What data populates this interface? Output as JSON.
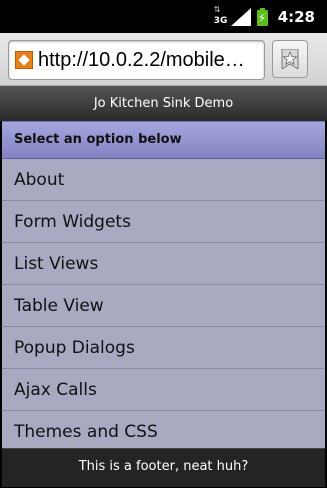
{
  "status_bar": {
    "time": "4:28",
    "data_indicator": "3G",
    "icons": [
      "data-3g-icon",
      "signal-icon",
      "battery-charging-icon"
    ]
  },
  "browser": {
    "url": "http://10.0.2.2/mobilew…",
    "icons": [
      "page-favicon",
      "bookmark-star-icon"
    ]
  },
  "app": {
    "title": "Jo Kitchen Sink Demo",
    "group_header": "Select an option below",
    "menu_items": [
      {
        "label": "About"
      },
      {
        "label": "Form Widgets"
      },
      {
        "label": "List Views"
      },
      {
        "label": "Table View"
      },
      {
        "label": "Popup Dialogs"
      },
      {
        "label": "Ajax Calls"
      },
      {
        "label": "Themes and CSS"
      }
    ],
    "footer": "This is a footer, neat huh?"
  },
  "colors": {
    "header_accent": "#9a9ad6",
    "list_background": "#a9a9c2",
    "battery": "#5cbf1e",
    "favicon": "#e5801c"
  }
}
